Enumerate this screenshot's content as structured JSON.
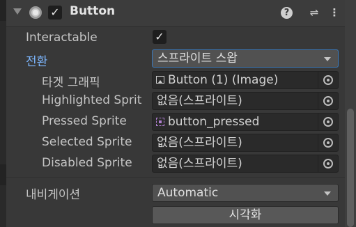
{
  "component": {
    "title": "Button",
    "enabled": true,
    "icons": [
      "foldout-arrow-icon",
      "component-icon",
      "help-icon",
      "preset-icon",
      "menu-icon"
    ]
  },
  "fields": {
    "interactable": {
      "label": "Interactable",
      "checked": true
    },
    "transition": {
      "label": "전환",
      "value": "스프라이트 스왑"
    },
    "target_graphic": {
      "label": "타겟 그래픽",
      "value": "Button (1) (Image)",
      "icon": "image-icon"
    },
    "highlighted_sprite": {
      "label": "Highlighted Sprit",
      "value": "없음(스프라이트)"
    },
    "pressed_sprite": {
      "label": "Pressed Sprite",
      "value": "button_pressed",
      "icon": "sprite-icon"
    },
    "selected_sprite": {
      "label": "Selected Sprite",
      "value": "없음(스프라이트)"
    },
    "disabled_sprite": {
      "label": "Disabled Sprite",
      "value": "없음(스프라이트)"
    },
    "navigation": {
      "label": "내비게이션",
      "value": "Automatic"
    },
    "visualize": {
      "label": "시각화"
    }
  },
  "colors": {
    "background": "#383838",
    "label": "#c4c4c4",
    "accent_label": "#7db7ff",
    "focus_border": "#3a79bb"
  }
}
